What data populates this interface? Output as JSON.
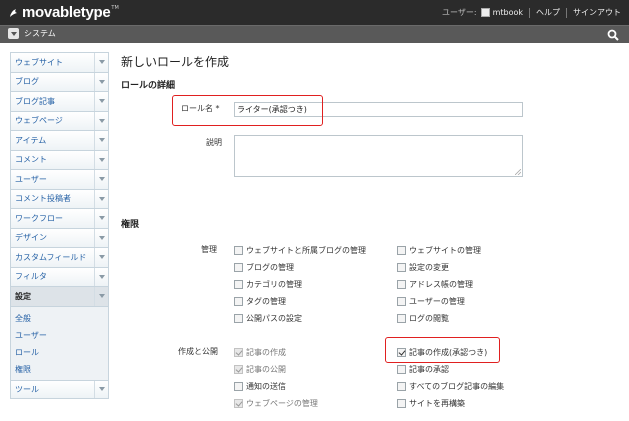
{
  "header": {
    "logo_text": "movabletype",
    "logo_tm": "TM",
    "user_label": "ユーザー:",
    "username": "mtbook",
    "help": "ヘルプ",
    "signout": "サインアウト"
  },
  "scope": {
    "label": "システム"
  },
  "sidebar": {
    "items": [
      {
        "label": "ウェブサイト"
      },
      {
        "label": "ブログ"
      },
      {
        "label": "ブログ記事"
      },
      {
        "label": "ウェブページ"
      },
      {
        "label": "アイテム"
      },
      {
        "label": "コメント"
      },
      {
        "label": "ユーザー"
      },
      {
        "label": "コメント投稿者"
      },
      {
        "label": "ワークフロー"
      },
      {
        "label": "デザイン"
      },
      {
        "label": "カスタムフィールド"
      },
      {
        "label": "フィルタ"
      },
      {
        "label": "設定"
      }
    ],
    "settings_sub": [
      {
        "label": "全般"
      },
      {
        "label": "ユーザー"
      },
      {
        "label": "ロール"
      },
      {
        "label": "権限"
      }
    ],
    "tools": {
      "label": "ツール"
    }
  },
  "main": {
    "page_title": "新しいロールを作成",
    "details_title": "ロールの詳細",
    "role_name_label": "ロール名",
    "required_mark": "*",
    "role_name_value": "ライター(承認つき)",
    "description_label": "説明",
    "description_value": "",
    "permissions_title": "権限",
    "admin_group_label": "管理",
    "create_group_label": "作成と公開",
    "admin_perms": [
      {
        "label": "ウェブサイトと所属ブログの管理",
        "checked": false,
        "disabled": false
      },
      {
        "label": "ウェブサイトの管理",
        "checked": false,
        "disabled": false
      },
      {
        "label": "ブログの管理",
        "checked": false,
        "disabled": false
      },
      {
        "label": "設定の変更",
        "checked": false,
        "disabled": false
      },
      {
        "label": "カテゴリの管理",
        "checked": false,
        "disabled": false
      },
      {
        "label": "アドレス帳の管理",
        "checked": false,
        "disabled": false
      },
      {
        "label": "タグの管理",
        "checked": false,
        "disabled": false
      },
      {
        "label": "ユーザーの管理",
        "checked": false,
        "disabled": false
      },
      {
        "label": "公開パスの設定",
        "checked": false,
        "disabled": false
      },
      {
        "label": "ログの閲覧",
        "checked": false,
        "disabled": false
      }
    ],
    "create_perms": [
      {
        "label": "記事の作成",
        "checked": true,
        "disabled": true
      },
      {
        "label": "記事の作成(承認つき)",
        "checked": true,
        "disabled": false
      },
      {
        "label": "記事の公開",
        "checked": true,
        "disabled": true
      },
      {
        "label": "記事の承認",
        "checked": false,
        "disabled": false
      },
      {
        "label": "通知の送信",
        "checked": false,
        "disabled": false
      },
      {
        "label": "すべてのブログ記事の編集",
        "checked": false,
        "disabled": false
      },
      {
        "label": "ウェブページの管理",
        "checked": true,
        "disabled": true
      },
      {
        "label": "サイトを再構築",
        "checked": false,
        "disabled": false
      }
    ]
  }
}
